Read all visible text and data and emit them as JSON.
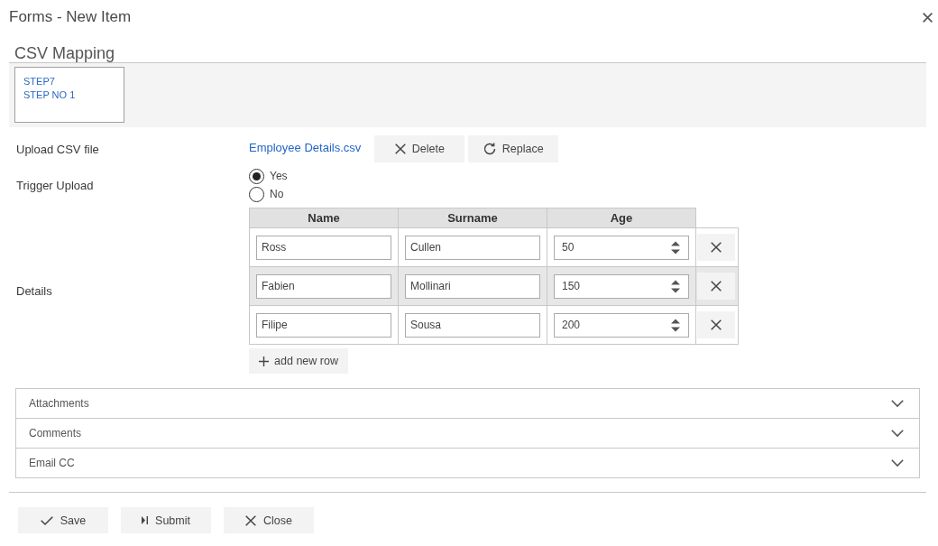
{
  "dialog": {
    "title": "Forms - New Item"
  },
  "section": {
    "title": "CSV Mapping",
    "step": {
      "title": "STEP7",
      "subtitle": "STEP NO 1"
    }
  },
  "fields": [
    {
      "kind": "file",
      "label": "Upload CSV file",
      "file_name": "Employee Details.csv",
      "actions": [
        {
          "kind": "delete",
          "label": "Delete"
        },
        {
          "kind": "replace",
          "label": "Replace"
        }
      ]
    },
    {
      "kind": "radio",
      "label": "Trigger Upload",
      "options": [
        {
          "label": "Yes",
          "selected": true
        },
        {
          "label": "No",
          "selected": false
        }
      ]
    },
    {
      "kind": "grid",
      "label": "Details",
      "columns": [
        {
          "label": "Name",
          "kind": "text"
        },
        {
          "label": "Surname",
          "kind": "text"
        },
        {
          "label": "Age",
          "kind": "number"
        }
      ],
      "rows": [
        [
          "Ross",
          "Cullen",
          "50"
        ],
        [
          "Fabien",
          "Mollinari",
          "150"
        ],
        [
          "Filipe",
          "Sousa",
          "200"
        ]
      ],
      "add_button": "add new row"
    }
  ],
  "accordion": [
    {
      "title": "Attachments",
      "expanded": false
    },
    {
      "title": "Comments",
      "expanded": false
    },
    {
      "title": "Email CC",
      "expanded": false
    }
  ],
  "footer_buttons": [
    {
      "kind": "save",
      "label": "Save"
    },
    {
      "kind": "submit",
      "label": "Submit"
    },
    {
      "kind": "close",
      "label": "Close"
    }
  ]
}
